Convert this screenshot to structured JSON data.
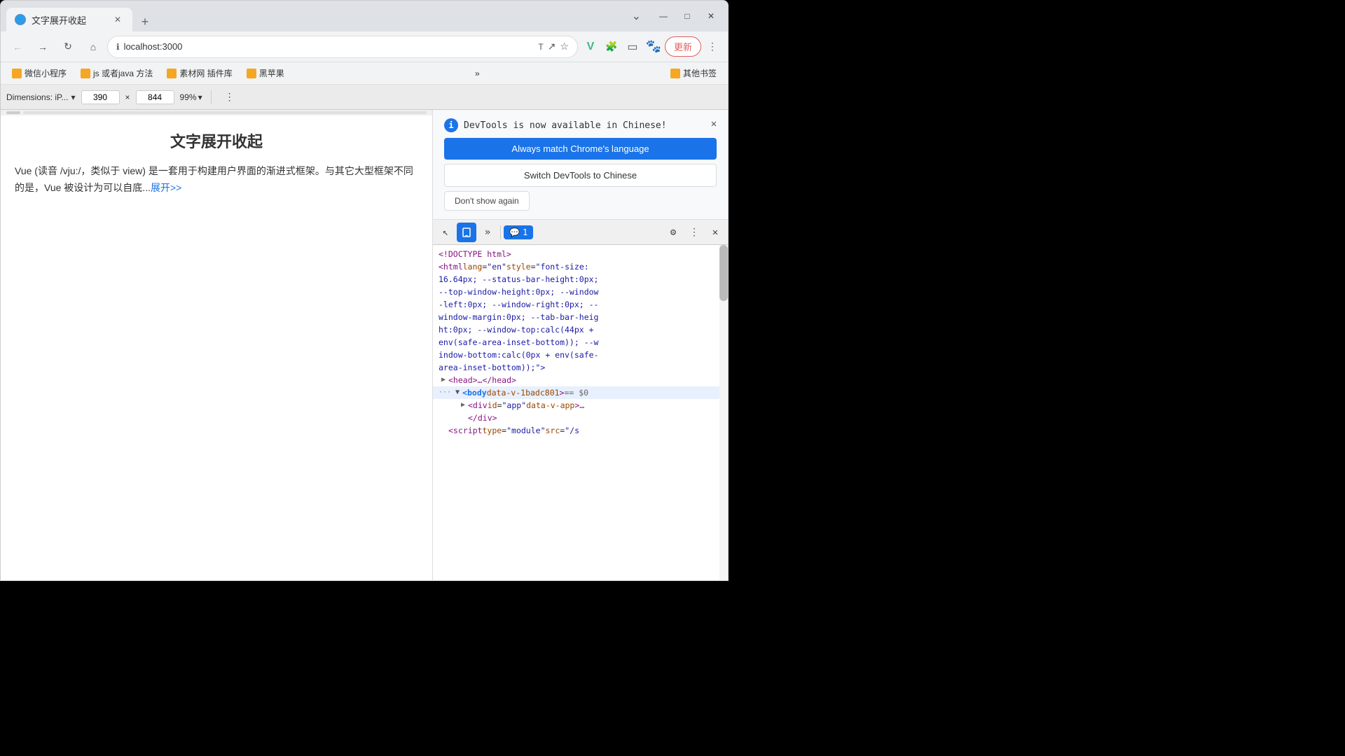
{
  "browser": {
    "tab_title": "文字展开收起",
    "tab_favicon": "🌐",
    "url": "localhost:3000",
    "new_tab_label": "+",
    "window_controls": {
      "minimize": "—",
      "maximize": "□",
      "close": "✕"
    }
  },
  "nav": {
    "back": "←",
    "forward": "→",
    "refresh": "↻",
    "home": "⌂",
    "translate_icon": "T",
    "share_icon": "↗",
    "star_icon": "☆",
    "vue_icon": "V",
    "extensions_icon": "🧩",
    "sidebar_icon": "▭",
    "profile_icon": "👤",
    "update_label": "更新",
    "more_icon": "⋮"
  },
  "bookmarks": [
    {
      "label": "微信小程序",
      "icon": "📁"
    },
    {
      "label": "js 或者java 方法",
      "icon": "📁"
    },
    {
      "label": "素材网 插件库",
      "icon": "📁"
    },
    {
      "label": "黑苹果",
      "icon": "📁"
    }
  ],
  "bookmarks_more": "»",
  "bookmarks_other": "其他书签",
  "device_toolbar": {
    "device_label": "Dimensions: iP...",
    "width": "390",
    "x_sep": "×",
    "height": "844",
    "zoom": "99%",
    "more_icon": "⋮"
  },
  "phone_content": {
    "title": "文字展开收起",
    "text": "Vue (读音 /vju:/，类似于 view) 是一套用于构建用户界面的渐进式框架。与其它大型框架不同的是，Vue 被设计为可以自底...",
    "link": "展开>>"
  },
  "devtools": {
    "lang_notification": {
      "info_text": "DevTools is now available in Chinese!",
      "btn_always": "Always match Chrome's language",
      "btn_switch": "Switch DevTools to Chinese",
      "btn_dont_show": "Don't show again"
    },
    "toolbar_icons": {
      "cursor": "↖",
      "device": "📱",
      "more_tabs": "»",
      "badge_icon": "💬",
      "badge_count": "1",
      "settings": "⚙",
      "more": "⋮",
      "close": "✕"
    },
    "code_lines": [
      {
        "indent": 0,
        "has_triangle": false,
        "content": "<!DOCTYPE html>"
      },
      {
        "indent": 0,
        "has_triangle": false,
        "content": "<html lang=\"en\" style=\"font-size:"
      },
      {
        "indent": 0,
        "has_triangle": false,
        "content": "16.64px; --status-bar-height:0px;"
      },
      {
        "indent": 0,
        "has_triangle": false,
        "content": "--top-window-height:0px; --window"
      },
      {
        "indent": 0,
        "has_triangle": false,
        "content": "-left:0px; --window-right:0px; --"
      },
      {
        "indent": 0,
        "has_triangle": false,
        "content": "window-margin:0px; --tab-bar-heig"
      },
      {
        "indent": 0,
        "has_triangle": false,
        "content": "ht:0px; --window-top:calc(44px +"
      },
      {
        "indent": 0,
        "has_triangle": false,
        "content": "env(safe-area-inset-bottom)); --w"
      },
      {
        "indent": 0,
        "has_triangle": false,
        "content": "indow-bottom:calc(0px + env(safe-"
      },
      {
        "indent": 0,
        "has_triangle": false,
        "content": "area-inset-bottom));\">"
      },
      {
        "indent": 1,
        "has_triangle": true,
        "collapsed": true,
        "content": "<head>…</head>"
      },
      {
        "indent": 0,
        "has_triangle": false,
        "is_highlighted": true,
        "content": "<body data-v-1badc801> == $0"
      },
      {
        "indent": 1,
        "has_triangle": true,
        "collapsed": true,
        "content": "<div id=\"app\" data-v-app>…"
      },
      {
        "indent": 4,
        "has_triangle": false,
        "content": "</div>"
      },
      {
        "indent": 1,
        "has_triangle": false,
        "content": "<script type=\"module\" src=\"/s"
      }
    ]
  }
}
